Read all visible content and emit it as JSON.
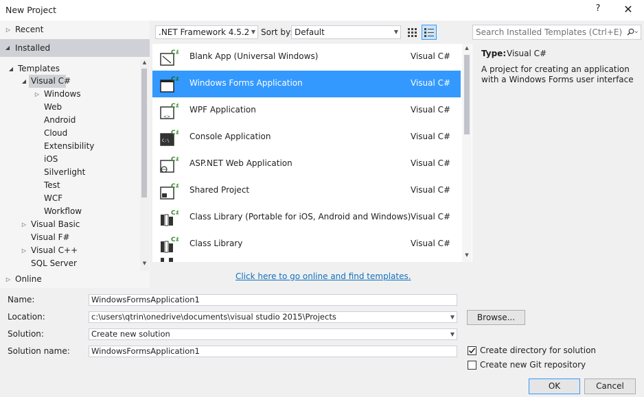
{
  "window": {
    "title": "New Project",
    "help": "?",
    "close": "✕"
  },
  "nav": {
    "recent": "Recent",
    "installed": "Installed",
    "templates": "Templates",
    "visual_csharp": "Visual C#",
    "windows": "Windows",
    "web": "Web",
    "android": "Android",
    "cloud": "Cloud",
    "extensibility": "Extensibility",
    "ios": "iOS",
    "silverlight": "Silverlight",
    "test": "Test",
    "wcf": "WCF",
    "workflow": "Workflow",
    "visual_basic": "Visual Basic",
    "visual_fsharp": "Visual F#",
    "visual_cpp": "Visual C++",
    "sql_server": "SQL Server",
    "online": "Online"
  },
  "toolbar": {
    "framework": ".NET Framework 4.5.2",
    "sort_label": "Sort by:",
    "sort_value": "Default",
    "search_placeholder": "Search Installed Templates (Ctrl+E)"
  },
  "templates": [
    {
      "name": "Blank App (Universal Windows)",
      "lang": "Visual C#",
      "icon": "universal-app-icon"
    },
    {
      "name": "Windows Forms Application",
      "lang": "Visual C#",
      "icon": "winforms-icon"
    },
    {
      "name": "WPF Application",
      "lang": "Visual C#",
      "icon": "wpf-icon"
    },
    {
      "name": "Console Application",
      "lang": "Visual C#",
      "icon": "console-icon"
    },
    {
      "name": "ASP.NET Web Application",
      "lang": "Visual C#",
      "icon": "web-app-icon"
    },
    {
      "name": "Shared Project",
      "lang": "Visual C#",
      "icon": "shared-project-icon"
    },
    {
      "name": "Class Library (Portable for iOS, Android and Windows)",
      "lang": "Visual C#",
      "icon": "class-library-icon"
    },
    {
      "name": "Class Library",
      "lang": "Visual C#",
      "icon": "class-library-icon"
    }
  ],
  "online_link": "Click here to go online and find templates.",
  "details": {
    "type_label": "Type:",
    "type_value": "Visual C#",
    "description": "A project for creating an application with a Windows Forms user interface"
  },
  "form": {
    "name_label": "Name:",
    "name_value": "WindowsFormsApplication1",
    "location_label": "Location:",
    "location_value": "c:\\users\\qtrin\\onedrive\\documents\\visual studio 2015\\Projects",
    "solution_label": "Solution:",
    "solution_value": "Create new solution",
    "solution_name_label": "Solution name:",
    "solution_name_value": "WindowsFormsApplication1",
    "browse": "Browse...",
    "create_dir": "Create directory for solution",
    "create_git": "Create new Git repository",
    "ok": "OK",
    "cancel": "Cancel"
  },
  "colors": {
    "accent": "#3399ff",
    "selection_gray": "#cfd1d6",
    "link": "#0e70c0",
    "csharp_green": "#388a34"
  }
}
